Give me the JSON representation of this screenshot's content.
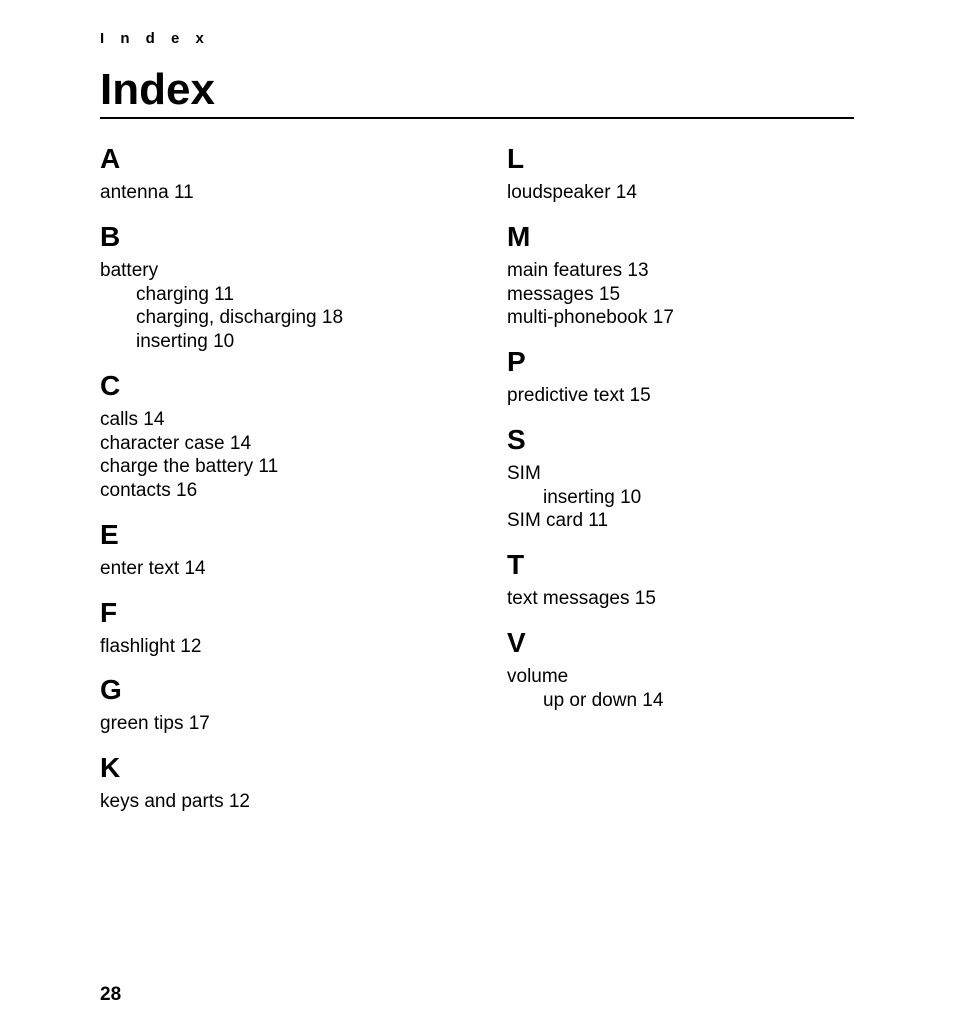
{
  "header": {
    "running": "I n d e x",
    "title": "Index",
    "page_number": "28"
  },
  "left": [
    {
      "letter": "A",
      "lines": [
        {
          "text": "antenna 11"
        }
      ]
    },
    {
      "letter": "B",
      "lines": [
        {
          "text": "battery"
        },
        {
          "text": "charging 11",
          "sub": true
        },
        {
          "text": "charging, discharging 18",
          "sub": true
        },
        {
          "text": "inserting 10",
          "sub": true
        }
      ]
    },
    {
      "letter": "C",
      "lines": [
        {
          "text": "calls 14"
        },
        {
          "text": "character case 14"
        },
        {
          "text": "charge the battery 11"
        },
        {
          "text": "contacts 16"
        }
      ]
    },
    {
      "letter": "E",
      "lines": [
        {
          "text": "enter text 14"
        }
      ]
    },
    {
      "letter": "F",
      "lines": [
        {
          "text": "flashlight 12"
        }
      ]
    },
    {
      "letter": "G",
      "lines": [
        {
          "text": "green tips 17"
        }
      ]
    },
    {
      "letter": "K",
      "lines": [
        {
          "text": "keys and parts 12"
        }
      ]
    }
  ],
  "right": [
    {
      "letter": "L",
      "lines": [
        {
          "text": "loudspeaker 14"
        }
      ]
    },
    {
      "letter": "M",
      "lines": [
        {
          "text": "main features 13"
        },
        {
          "text": "messages 15"
        },
        {
          "text": "multi-phonebook 17"
        }
      ]
    },
    {
      "letter": "P",
      "lines": [
        {
          "text": "predictive text 15"
        }
      ]
    },
    {
      "letter": "S",
      "lines": [
        {
          "text": "SIM"
        },
        {
          "text": "inserting 10",
          "sub": true
        },
        {
          "text": "SIM card 11"
        }
      ]
    },
    {
      "letter": "T",
      "lines": [
        {
          "text": "text messages 15"
        }
      ]
    },
    {
      "letter": "V",
      "lines": [
        {
          "text": "volume"
        },
        {
          "text": "up or down 14",
          "sub": true
        }
      ]
    }
  ]
}
